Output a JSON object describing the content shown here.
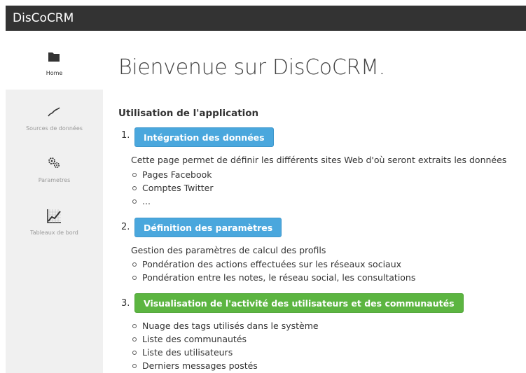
{
  "app": {
    "brand": "DisCoCRM"
  },
  "sidebar": {
    "items": [
      {
        "label": "Home",
        "icon": "folder-icon",
        "active": true
      },
      {
        "label": "Sources de données",
        "icon": "trend-line-icon",
        "active": false
      },
      {
        "label": "Parametres",
        "icon": "gears-icon",
        "active": false
      },
      {
        "label": "Tableaux de bord",
        "icon": "chart-icon",
        "active": false
      }
    ]
  },
  "main": {
    "title": "Bienvenue sur DisCoCRM.",
    "section_title": "Utilisation de l'application",
    "steps": [
      {
        "number": "1.",
        "button": "Intégration des données",
        "color": "#4aa7dd",
        "description": "Cette page permet de définir les différents sites Web d'où seront extraits les données",
        "bullets": [
          "Pages Facebook",
          "Comptes Twitter",
          "..."
        ]
      },
      {
        "number": "2.",
        "button": "Définition des paramètres",
        "color": "#4aa7dd",
        "description": "Gestion des paramètres de calcul des profils",
        "bullets": [
          "Pondération des actions effectuées sur les réseaux sociaux",
          "Pondération entre les notes, le réseau social, les consultations"
        ]
      },
      {
        "number": "3.",
        "button": "Visualisation de l'activité des utilisateurs et des communautés",
        "color": "#5cb541",
        "description": "",
        "bullets": [
          "Nuage des tags utilisés dans le système",
          "Liste des communautés",
          "Liste des utilisateurs",
          "Derniers messages postés"
        ]
      }
    ]
  }
}
